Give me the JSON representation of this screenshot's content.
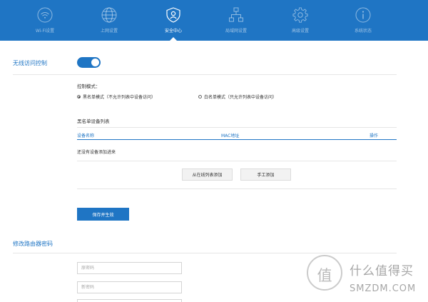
{
  "nav": {
    "items": [
      {
        "label": "Wi-Fi设置",
        "icon": "wifi-icon",
        "active": false
      },
      {
        "label": "上网设置",
        "icon": "globe-icon",
        "active": false
      },
      {
        "label": "安全中心",
        "icon": "shield-user-icon",
        "active": true
      },
      {
        "label": "局域网设置",
        "icon": "network-icon",
        "active": false
      },
      {
        "label": "高级设置",
        "icon": "gear-icon",
        "active": false
      },
      {
        "label": "系统状态",
        "icon": "info-icon",
        "active": false
      }
    ]
  },
  "wireless_access": {
    "title": "无线访问控制",
    "toggle_on": true,
    "mode_label": "控制模式：",
    "modes": [
      {
        "label": "黑名单模式（不允许列表中设备访问）",
        "selected": true
      },
      {
        "label": "白名单模式（只允许列表中设备访问）",
        "selected": false
      }
    ],
    "list_title": "黑名单设备列表",
    "columns": {
      "name": "设备名称",
      "mac": "MAC地址",
      "action": "操作"
    },
    "empty_text": "还没有设备添加进来",
    "add_online_button": "从在线列表添加",
    "add_manual_button": "手工添加",
    "save_button": "保存并生效"
  },
  "router_password": {
    "title": "修改路由器密码",
    "old_password_placeholder": "原密码",
    "new_password_placeholder": "新密码"
  },
  "watermark": {
    "icon_char": "值",
    "line1": "什么值得买",
    "line2": "SMZDM.COM"
  },
  "colors": {
    "primary": "#1f75c4"
  }
}
